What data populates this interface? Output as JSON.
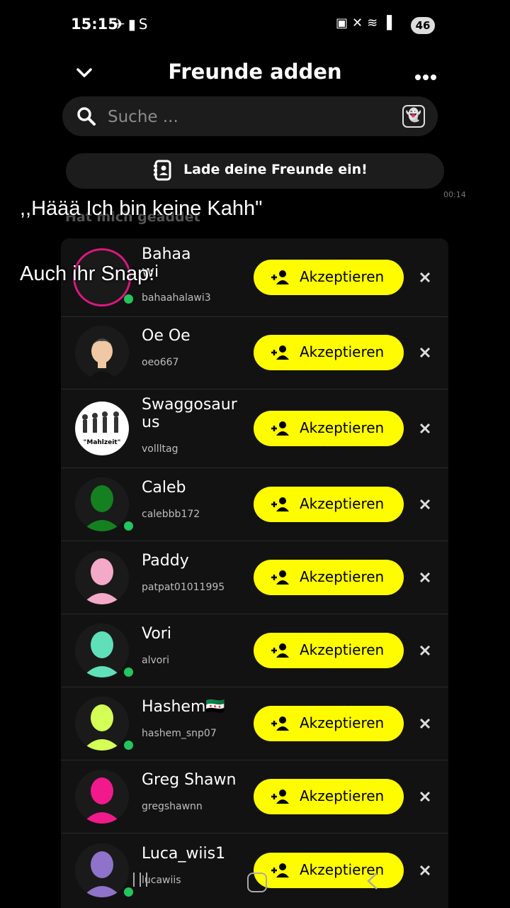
{
  "status_bar": {
    "time": "15:15",
    "left_icons": [
      "notification-icon",
      "sim-icon",
      "s-icon"
    ],
    "right_icons": [
      "cast-icon",
      "mute-icon",
      "wifi-icon",
      "signal-icon"
    ],
    "battery": "46"
  },
  "header": {
    "title": "Freunde adden"
  },
  "search": {
    "placeholder": "Suche ..."
  },
  "invite": {
    "label": "Lade deine Freunde ein!"
  },
  "side_timestamp": "00:14",
  "section": {
    "title": "Hat mich geaddet"
  },
  "overlay": {
    "line1": ",,Häää Ich bin keine Kahh\"",
    "line2": "Auch ihr Snap:"
  },
  "accept_label": "Akzeptieren",
  "requests": [
    {
      "name": "Bahaa",
      "name2": "wi",
      "username": "bahaahalawi3",
      "online": true,
      "avatar_color": "#1a1a1a"
    },
    {
      "name": "Oe Oe",
      "name2": "",
      "username": "oeo667",
      "online": false,
      "avatar_color": "#1a1a1a"
    },
    {
      "name": "Swaggosaur",
      "name2": "us",
      "username": "vollltag",
      "online": false,
      "avatar_color": "#ffffff",
      "avatar_caption": "\"Mahlzeit\""
    },
    {
      "name": "Caleb",
      "name2": "",
      "username": "calebbb172",
      "online": true,
      "avatar_color": "#15801f"
    },
    {
      "name": "Paddy",
      "name2": "",
      "username": "patpat01011995",
      "online": false,
      "avatar_color": "#f4a9c8"
    },
    {
      "name": "Vori",
      "name2": "",
      "username": "alvori",
      "online": true,
      "avatar_color": "#5fe0b8"
    },
    {
      "name": "Hashem🇸🇾",
      "name2": "",
      "username": "hashem_snp07",
      "online": true,
      "avatar_color": "#d4ff55"
    },
    {
      "name": "Greg Shawn",
      "name2": "",
      "username": "gregshawnn",
      "online": false,
      "avatar_color": "#f01a8c"
    },
    {
      "name": "Luca_wiis1",
      "name2": "",
      "username": "lucawiis",
      "online": true,
      "avatar_color": "#8f72c9"
    }
  ]
}
